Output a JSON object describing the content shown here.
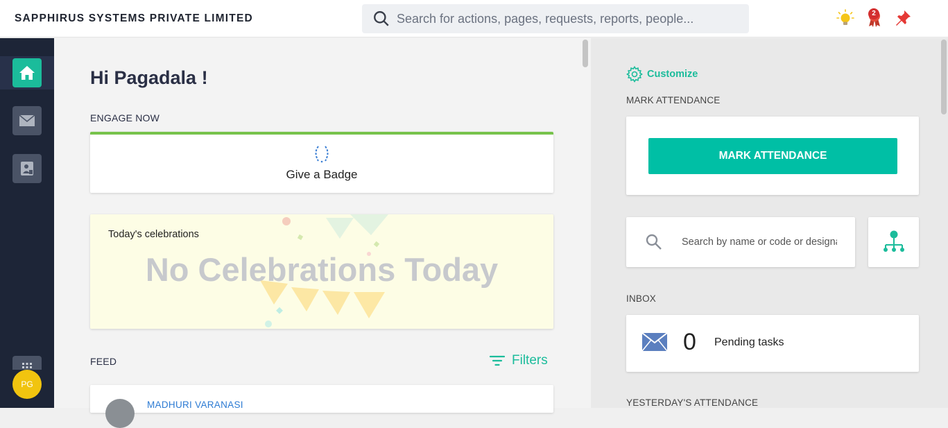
{
  "header": {
    "company_name": "SAPPHIRUS SYSTEMS PRIVATE LIMITED",
    "search_placeholder": "Search for actions, pages, requests, reports, people...",
    "notification_count": "2"
  },
  "sidebar": {
    "items": [
      {
        "name": "home",
        "active": true
      },
      {
        "name": "inbox"
      },
      {
        "name": "attendance"
      }
    ],
    "avatar_initials": "PG"
  },
  "main": {
    "greeting": "Hi Pagadala !",
    "engage_label": "ENGAGE NOW",
    "give_badge_label": "Give a Badge",
    "celebrations_title": "Today's celebrations",
    "celebrations_empty": "No Celebrations Today",
    "feed_label": "FEED",
    "filters_label": "Filters",
    "feed_first_author": "MADHURI VARANASI"
  },
  "right": {
    "customize_label": "Customize",
    "mark_attendance_label": "MARK ATTENDANCE",
    "mark_attendance_button": "MARK ATTENDANCE",
    "people_search_placeholder": "Search by name or code or designation",
    "inbox_label": "INBOX",
    "pending_count": "0",
    "pending_label": "Pending tasks",
    "yesterday_label": "YESTERDAY'S ATTENDANCE"
  },
  "colors": {
    "accent": "#1bbc9b",
    "sidebar_bg": "#1d2537",
    "badge_red": "#d32f2f"
  }
}
